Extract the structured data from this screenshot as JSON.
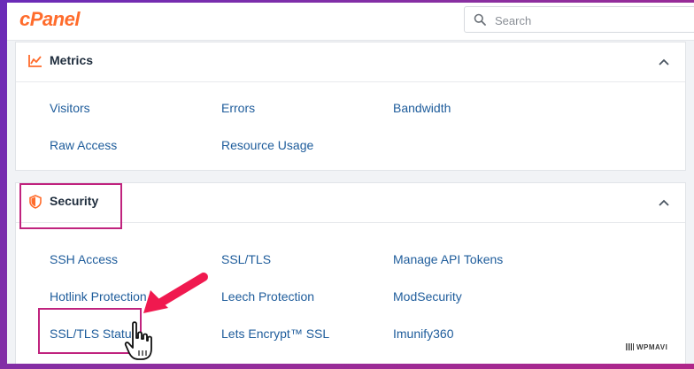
{
  "app": {
    "logo": "cPanel"
  },
  "search": {
    "placeholder": "Search"
  },
  "metrics": {
    "title": "Metrics",
    "items": [
      "Visitors",
      "Errors",
      "Bandwidth",
      "Raw Access",
      "Resource Usage"
    ]
  },
  "security": {
    "title": "Security",
    "items": [
      "SSH Access",
      "SSL/TLS",
      "Manage API Tokens",
      "Hotlink Protection",
      "Leech Protection",
      "ModSecurity",
      "SSL/TLS Status",
      "Lets Encrypt™ SSL",
      "Imunify360"
    ]
  },
  "watermark": "WPMAVI",
  "colors": {
    "accent": "#ff6c2c",
    "link": "#1e5c9b",
    "highlight": "#c0237e",
    "arrow": "#f0194f"
  }
}
